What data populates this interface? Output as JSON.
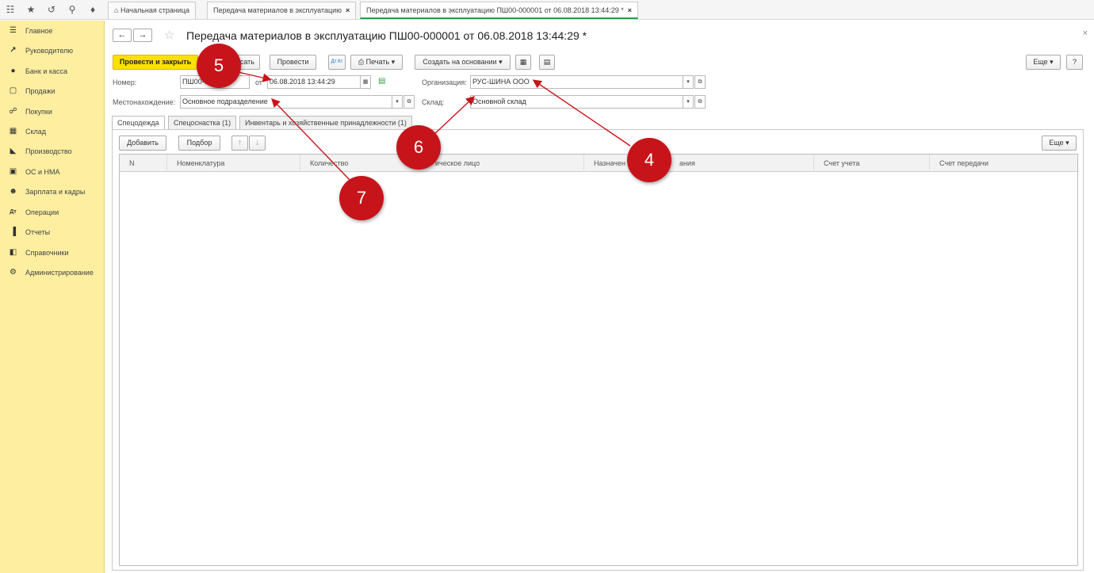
{
  "topbar": {
    "tabs": [
      {
        "label": "Начальная страница"
      },
      {
        "label": "Передача материалов в эксплуатацию"
      },
      {
        "label": "Передача материалов в эксплуатацию ПШ00-000001 от 06.08.2018 13:44:29 *"
      }
    ]
  },
  "sidebar": {
    "items": [
      {
        "label": "Главное",
        "icon": "menu-icon"
      },
      {
        "label": "Руководителю",
        "icon": "trend-icon"
      },
      {
        "label": "Банк и касса",
        "icon": "bank-icon"
      },
      {
        "label": "Продажи",
        "icon": "bag-icon"
      },
      {
        "label": "Покупки",
        "icon": "cart-icon"
      },
      {
        "label": "Склад",
        "icon": "warehouse-icon"
      },
      {
        "label": "Производство",
        "icon": "factory-icon"
      },
      {
        "label": "ОС и НМА",
        "icon": "truck-icon"
      },
      {
        "label": "Зарплата и кадры",
        "icon": "person-icon"
      },
      {
        "label": "Операции",
        "icon": "dt-kt-icon"
      },
      {
        "label": "Отчеты",
        "icon": "bar-chart-icon"
      },
      {
        "label": "Справочники",
        "icon": "book-icon"
      },
      {
        "label": "Администрирование",
        "icon": "gear-icon"
      }
    ]
  },
  "document": {
    "title": "Передача материалов в эксплуатацию ПШ00-000001 от 06.08.2018 13:44:29 *",
    "toolbar": {
      "post_and_close": "Провести и закрыть",
      "write": "исать",
      "post": "Провести",
      "dtkt": "Дт Кт",
      "print": "Печать",
      "create_based": "Создать на основании",
      "more": "Еще",
      "help": "?"
    },
    "fields": {
      "number_label": "Номер:",
      "number_value": "ПШ00-00",
      "from_label": "от",
      "date_value": "06.08.2018 13:44:29",
      "org_label": "Организация:",
      "org_value": "РУС-ШИНА ООО",
      "location_label": "Местонахождение:",
      "location_value": "Основное подразделение",
      "warehouse_label": "Склад:",
      "warehouse_value": "Основной склад"
    },
    "tabs": [
      {
        "label": "Спецодежда"
      },
      {
        "label": "Спецоснастка (1)"
      },
      {
        "label": "Инвентарь и хозяйственные принадлежности (1)"
      }
    ],
    "table_toolbar": {
      "add": "Добавить",
      "select": "Подбор",
      "more": "Еще"
    },
    "table_columns": [
      "N",
      "Номенклатура",
      "Количество",
      "ическое лицо",
      "Назначен",
      "ания",
      "Счет учета",
      "Счет передачи"
    ],
    "table_rows": []
  },
  "annotations": {
    "markers": [
      "5",
      "6",
      "4",
      "7"
    ],
    "marker_color": "#c7141a"
  }
}
